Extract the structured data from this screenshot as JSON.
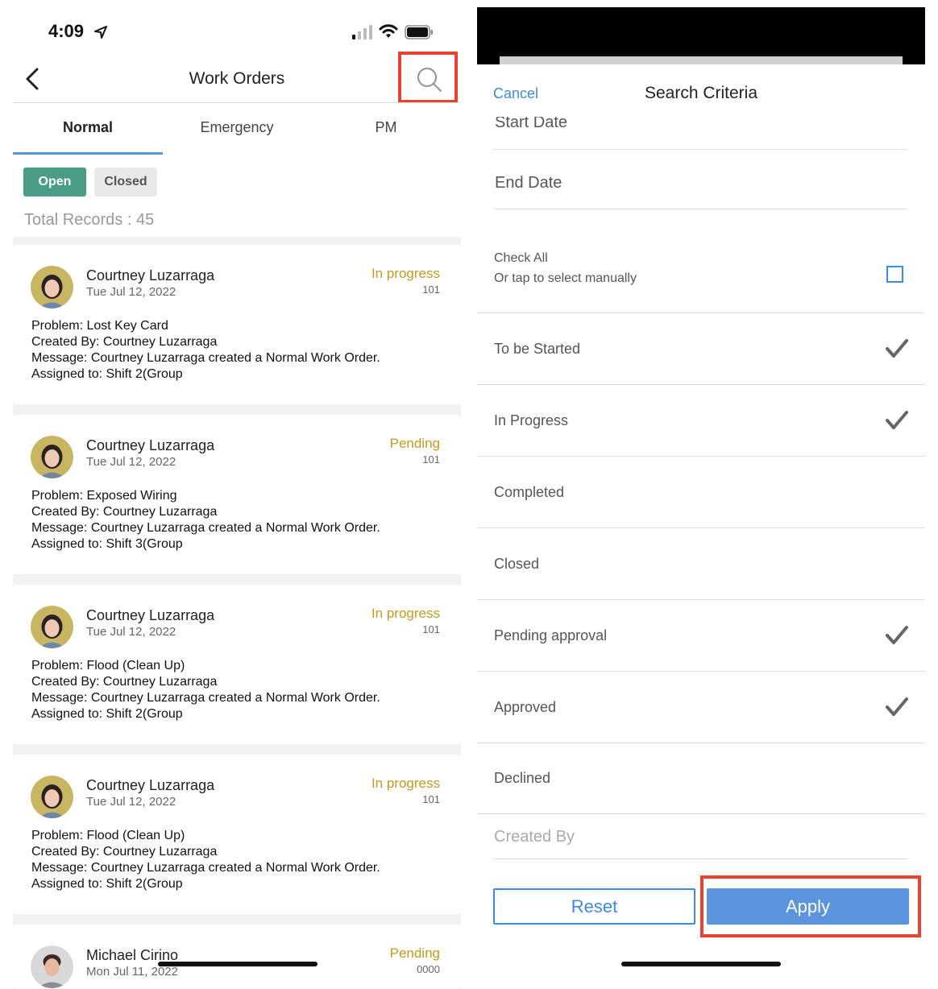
{
  "left": {
    "status_time": "4:09",
    "nav_title": "Work Orders",
    "tabs": [
      {
        "label": "Normal"
      },
      {
        "label": "Emergency"
      },
      {
        "label": "PM"
      }
    ],
    "filters": {
      "open": "Open",
      "closed": "Closed"
    },
    "total_records": "Total Records : 45",
    "cards": [
      {
        "name": "Courtney Luzarraga",
        "date": "Tue Jul 12, 2022",
        "status": "In progress",
        "number": "101",
        "problem": "Problem: Lost Key Card",
        "created_by": "Created By: Courtney Luzarraga",
        "message": "Message: Courtney Luzarraga created a Normal Work Order.",
        "assigned": "Assigned to: Shift 2(Group"
      },
      {
        "name": "Courtney Luzarraga",
        "date": "Tue Jul 12, 2022",
        "status": "Pending",
        "number": "101",
        "problem": "Problem: Exposed Wiring",
        "created_by": "Created By: Courtney Luzarraga",
        "message": "Message: Courtney Luzarraga created a Normal Work Order.",
        "assigned": "Assigned to: Shift 3(Group"
      },
      {
        "name": "Courtney Luzarraga",
        "date": "Tue Jul 12, 2022",
        "status": "In progress",
        "number": "101",
        "problem": "Problem: Flood (Clean Up)",
        "created_by": "Created By: Courtney Luzarraga",
        "message": "Message: Courtney Luzarraga created a Normal Work Order.",
        "assigned": "Assigned to: Shift 2(Group"
      },
      {
        "name": "Courtney Luzarraga",
        "date": "Tue Jul 12, 2022",
        "status": "In progress",
        "number": "101",
        "problem": "Problem: Flood (Clean Up)",
        "created_by": "Created By: Courtney Luzarraga",
        "message": "Message: Courtney Luzarraga created a Normal Work Order.",
        "assigned": "Assigned to: Shift 2(Group"
      },
      {
        "name": "Michael Cirino",
        "date": "Mon Jul 11, 2022",
        "status": "Pending",
        "number": "0000"
      }
    ]
  },
  "right": {
    "cancel": "Cancel",
    "title": "Search Criteria",
    "start_date": "Start Date",
    "end_date": "End Date",
    "check_all": "Check All",
    "check_all_sub": "Or tap to select manually",
    "options": [
      {
        "label": "To be Started",
        "checked": true
      },
      {
        "label": "In Progress",
        "checked": true
      },
      {
        "label": "Completed",
        "checked": false
      },
      {
        "label": "Closed",
        "checked": false
      },
      {
        "label": "Pending approval",
        "checked": true
      },
      {
        "label": "Approved",
        "checked": true
      },
      {
        "label": "Declined",
        "checked": false
      }
    ],
    "created_by": "Created By",
    "reset": "Reset",
    "apply": "Apply"
  },
  "colors": {
    "accent_blue": "#3d8be0",
    "apply_blue": "#5a95de",
    "open_green": "#4a9d85",
    "status_gold": "#c29a1e",
    "highlight_red": "#e8432f"
  },
  "icons": [
    "location-arrow-icon",
    "cell-signal-icon",
    "wifi-icon",
    "battery-icon",
    "back-chevron-icon",
    "search-icon",
    "checkmark-icon"
  ]
}
